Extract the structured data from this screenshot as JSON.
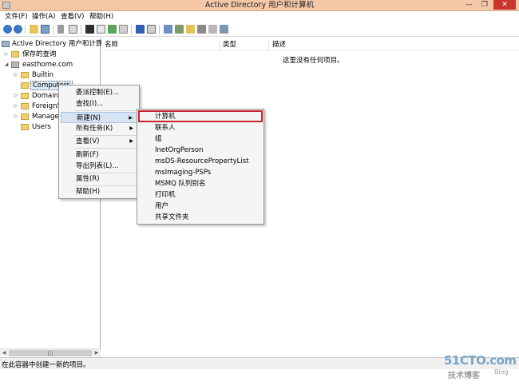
{
  "window": {
    "title": "Active Directory 用户和计算机",
    "min_glyph": "—",
    "max_glyph": "❐",
    "close_glyph": "✕"
  },
  "menu": [
    "文件(F)",
    "操作(A)",
    "查看(V)",
    "帮助(H)"
  ],
  "toolbar_icons": [
    "back-icon",
    "forward-icon",
    "up-folder-icon",
    "show-tree-icon",
    "cut-icon",
    "copy-icon",
    "delete-icon",
    "properties-icon",
    "refresh-icon",
    "export-icon",
    "help-icon",
    "console-icon",
    "new-user-icon",
    "new-group-icon",
    "new-ou-icon",
    "filter-icon",
    "find-icon",
    "add-to-group-icon"
  ],
  "tree": {
    "root": "Active Directory 用户和计算机",
    "saved_queries": "保存的查询",
    "domain": "easthome.com",
    "items": [
      "Builtin",
      "Computers",
      "Domain",
      "ForeignS",
      "Managed",
      "Users"
    ]
  },
  "list": {
    "columns": [
      "名称",
      "类型",
      "描述"
    ],
    "empty_message": "这里没有任何项目。"
  },
  "context_menu": {
    "items": [
      "委派控制(E)...",
      "查找(I)...",
      "新建(N)",
      "所有任务(K)",
      "查看(V)",
      "刷新(F)",
      "导出列表(L)...",
      "属性(R)",
      "帮助(H)"
    ]
  },
  "submenu": {
    "items": [
      "计算机",
      "联系人",
      "组",
      "InetOrgPerson",
      "msDS-ResourcePropertyList",
      "msImaging-PSPs",
      "MSMQ 队列别名",
      "打印机",
      "用户",
      "共享文件夹"
    ]
  },
  "status": "在此容器中创建一新的项目。",
  "scrollbar": {
    "left_arrow": "◀",
    "right_arrow": "▶",
    "grip": "|||"
  },
  "watermark": {
    "logo": "51CTO.com",
    "line1": "技术博客",
    "line2": "Blog"
  },
  "colors": {
    "titlebar": "#f4c8a7",
    "close_button": "#c7372d",
    "highlight_border": "#c4262e",
    "menu_hover": "#d5e3f3"
  }
}
